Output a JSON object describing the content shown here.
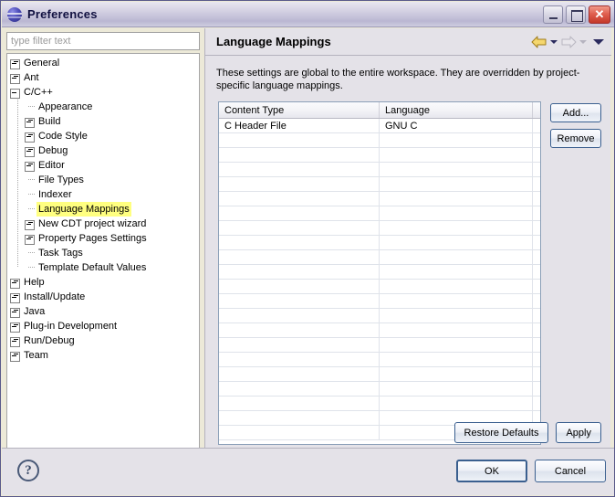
{
  "window": {
    "title": "Preferences",
    "icon": "eclipse-sphere-icon",
    "minimize_label": "",
    "maximize_label": "",
    "close_label": "✕"
  },
  "filter": {
    "placeholder": "type filter text",
    "value": ""
  },
  "tree": {
    "items": [
      {
        "label": "General",
        "indent": 0,
        "toggle": "collapsed",
        "highlight": false
      },
      {
        "label": "Ant",
        "indent": 0,
        "toggle": "collapsed",
        "highlight": false
      },
      {
        "label": "C/C++",
        "indent": 0,
        "toggle": "expanded",
        "highlight": false
      },
      {
        "label": "Appearance",
        "indent": 1,
        "toggle": "leaf",
        "highlight": false
      },
      {
        "label": "Build",
        "indent": 1,
        "toggle": "collapsed",
        "highlight": false
      },
      {
        "label": "Code Style",
        "indent": 1,
        "toggle": "collapsed",
        "highlight": false
      },
      {
        "label": "Debug",
        "indent": 1,
        "toggle": "collapsed",
        "highlight": false
      },
      {
        "label": "Editor",
        "indent": 1,
        "toggle": "collapsed",
        "highlight": false
      },
      {
        "label": "File Types",
        "indent": 1,
        "toggle": "leaf",
        "highlight": false
      },
      {
        "label": "Indexer",
        "indent": 1,
        "toggle": "leaf",
        "highlight": false
      },
      {
        "label": "Language Mappings",
        "indent": 1,
        "toggle": "leaf",
        "highlight": true
      },
      {
        "label": "New CDT project wizard",
        "indent": 1,
        "toggle": "collapsed",
        "highlight": false
      },
      {
        "label": "Property Pages Settings",
        "indent": 1,
        "toggle": "collapsed",
        "highlight": false
      },
      {
        "label": "Task Tags",
        "indent": 1,
        "toggle": "leaf",
        "highlight": false
      },
      {
        "label": "Template Default Values",
        "indent": 1,
        "toggle": "leaf",
        "highlight": false
      },
      {
        "label": "Help",
        "indent": 0,
        "toggle": "collapsed",
        "highlight": false
      },
      {
        "label": "Install/Update",
        "indent": 0,
        "toggle": "collapsed",
        "highlight": false
      },
      {
        "label": "Java",
        "indent": 0,
        "toggle": "collapsed",
        "highlight": false
      },
      {
        "label": "Plug-in Development",
        "indent": 0,
        "toggle": "collapsed",
        "highlight": false
      },
      {
        "label": "Run/Debug",
        "indent": 0,
        "toggle": "collapsed",
        "highlight": false
      },
      {
        "label": "Team",
        "indent": 0,
        "toggle": "collapsed",
        "highlight": false
      }
    ]
  },
  "page": {
    "title": "Language Mappings",
    "description": "These settings are global to the entire workspace.  They are overridden by project-specific language mappings.",
    "nav": {
      "back_icon": "arrow-left-icon",
      "back_menu_icon": "chevron-down-icon",
      "forward_icon": "arrow-right-icon",
      "forward_menu_icon": "chevron-down-icon",
      "menu_icon": "chevron-down-icon"
    }
  },
  "table": {
    "columns": [
      "Content Type",
      "Language",
      ""
    ],
    "rows": [
      [
        "C Header File",
        "GNU C",
        ""
      ]
    ],
    "empty_row_count": 21
  },
  "side_buttons": {
    "add": "Add...",
    "remove": "Remove"
  },
  "page_buttons": {
    "restore_defaults": "Restore Defaults",
    "apply": "Apply"
  },
  "footer": {
    "help": "?",
    "ok": "OK",
    "cancel": "Cancel"
  },
  "colors": {
    "highlight": "#ffff80",
    "dialog_bg": "#e4e2e8",
    "title_accent": "#c9c6dc",
    "button_border": "#3a5f8f",
    "close_red": "#c43828"
  }
}
